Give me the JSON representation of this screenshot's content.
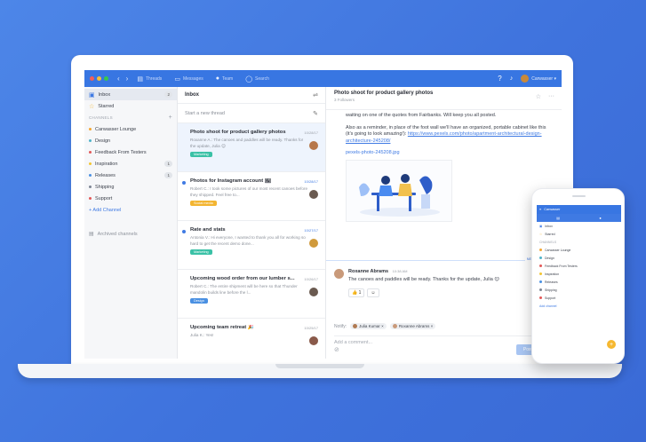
{
  "window": {
    "nav_back": "‹",
    "nav_forward": "›",
    "tabs": [
      {
        "icon": "threads-icon",
        "label": "Threads"
      },
      {
        "icon": "messages-icon",
        "label": "Messages"
      },
      {
        "icon": "team-icon",
        "label": "Team"
      },
      {
        "icon": "search-icon",
        "label": "Search"
      }
    ],
    "user_label": "Carwasser ▾"
  },
  "sidebar": {
    "items": [
      {
        "label": "Inbox",
        "count": "2"
      },
      {
        "label": "Starred"
      }
    ],
    "channels_header": "CHANNELS",
    "channels": [
      {
        "label": "Carwasser Lounge",
        "color": "#f3a631"
      },
      {
        "label": "Design",
        "color": "#4fb3c9"
      },
      {
        "label": "Feedback From Testers",
        "color": "#e25858"
      },
      {
        "label": "Inspiration",
        "color": "#f3c531",
        "count": "1"
      },
      {
        "label": "Releases",
        "color": "#4a90e2",
        "count": "1"
      },
      {
        "label": "Shipping",
        "color": "#7c8593"
      },
      {
        "label": "Support",
        "color": "#e25858"
      }
    ],
    "add_channel": "+ Add Channel",
    "archived": "Archived channels"
  },
  "threads": {
    "header": "Inbox",
    "new_thread": "Start a new thread",
    "items": [
      {
        "title": "Photo shoot for product gallery photos",
        "date": "10/28/17",
        "snippet": "Roxanne A.: The canoes and paddles will be ready. Thanks for the update, Julia 😊",
        "tag": "Marketing",
        "tag_color": "#3ac1a6",
        "selected": true,
        "unread": false
      },
      {
        "title": "Photos for Instagram account 🖼",
        "date": "10/28/17",
        "snippet": "Robert C.: I took some pictures of our most recent canoes before they shipped. Feel free to...",
        "tag": "Social media",
        "tag_color": "#f3b531",
        "selected": false,
        "unread": true
      },
      {
        "title": "Rate and stats",
        "date": "10/27/17",
        "snippet": "Antonia V.: Hi everyone, I wanted to thank you all for working so hard to get the recent demo done...",
        "tag": "Marketing",
        "tag_color": "#3ac1a6",
        "selected": false,
        "unread": true
      },
      {
        "title": "Upcoming wood order from our lumber s...",
        "date": "10/26/17",
        "snippet": "Robert C.: The entire shipment will be here so that Thunder mandolin builds line before the l...",
        "tag": "Design",
        "tag_color": "#4a90e2",
        "selected": false,
        "unread": false
      },
      {
        "title": "Upcoming team retreat 🎉",
        "date": "10/25/17",
        "snippet": "Julia K.: Yes!",
        "tag": "",
        "selected": false,
        "unread": false
      }
    ]
  },
  "detail": {
    "title": "Photo shoot for product gallery photos",
    "followers": "3 Followers",
    "message_p1": "waiting on one of the quotes from Fairbanks. Will keep you all posted.",
    "message_p2": "Also as a reminder, in place of the foot wall we'll have an organized, portable cabinet like this (it's going to look amazing!):",
    "link": "https://www.pexels.com/photo/apartment-architectural-design-architecture-245208/",
    "file": "pexels-photo-245208.jpg",
    "divider_label": "NEW MESSAGES",
    "reply_name": "Roxanne Abrams",
    "reply_time": "10:38 AM",
    "reply_text": "The canoes and paddles will be ready. Thanks for the update, Julia 😊",
    "reaction_count": "👍 1",
    "notify_label": "Notify:",
    "notify_people": [
      "Julia Kumar ×",
      "Roxanne Abrams ×"
    ],
    "comment_placeholder": "Add a comment...",
    "post_button": "Post Comment"
  },
  "phone": {
    "app_title": "Carwasser",
    "items": [
      "Inbox",
      "Starred",
      "CHANNELS",
      "Carwasser Lounge",
      "Design",
      "Feedback From Testers",
      "Inspiration",
      "Releases",
      "Shipping",
      "Support",
      "Add channel"
    ]
  }
}
